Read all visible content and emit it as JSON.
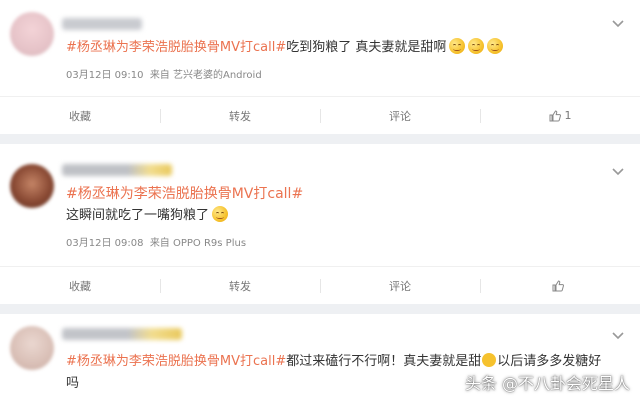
{
  "posts": [
    {
      "topic": "#杨丞琳为李荣浩脱胎换骨MV打call#",
      "text": "吃到狗粮了 真夫妻就是甜啊",
      "emoji_count": 3,
      "date": "03月12日 09:10",
      "via_prefix": "来自",
      "source": "艺兴老婆的Android",
      "actions": {
        "repost": "收藏",
        "forward": "转发",
        "comment": "评论",
        "like_count": "1"
      }
    },
    {
      "topic": "#杨丞琳为李荣浩脱胎换骨MV打call#",
      "text": "这瞬间就吃了一嘴狗粮了",
      "date": "03月12日 09:08",
      "via_prefix": "来自",
      "source": "OPPO R9s Plus",
      "actions": {
        "repost": "收藏",
        "forward": "转发",
        "comment": "评论",
        "like_count": ""
      }
    },
    {
      "topic": "#杨丞琳为李荣浩脱胎换骨MV打call#",
      "text": "都过来磕行不行啊！真夫妻就是甜",
      "text_after": "以后请多多发糖好",
      "text_line2": "吗"
    }
  ],
  "watermark": "头条 @不八卦会死星人",
  "colors": {
    "topic": "#eb7350",
    "background": "#eef0f3",
    "card": "#ffffff"
  }
}
